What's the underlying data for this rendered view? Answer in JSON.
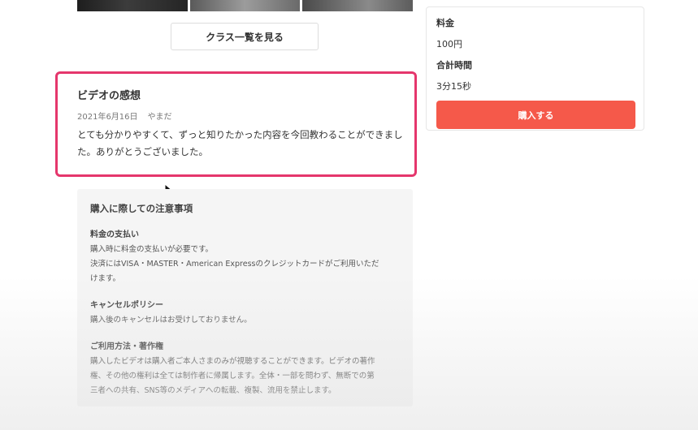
{
  "class_list_button": {
    "label": "クラス一覧を見る"
  },
  "review": {
    "title": "ビデオの感想",
    "date": "2021年6月16日",
    "author": "やまだ",
    "body_line1": "とても分かりやすくて、ずっと知りたかった内容を今回教わることができまし",
    "body_line2": "た。ありがとうございました。"
  },
  "notes": {
    "title": "購入に際しての注意事項",
    "payment": {
      "heading": "料金の支払い",
      "line1": "購入時に料金の支払いが必要です。",
      "line2": "決済にはVISA・MASTER・American Expressのクレジットカードがご利用いただ",
      "line3": "けます。"
    },
    "cancel": {
      "heading": "キャンセルポリシー",
      "line1": "購入後のキャンセルはお受けしておりません。"
    },
    "usage": {
      "heading": "ご利用方法・著作権",
      "line1": "購入したビデオは購入者ご本人さまのみが視聴することができます。ビデオの著作",
      "line2": "権、その他の権利は全ては制作者に帰属します。全体・一部を問わず、無断での第",
      "line3": "三者への共有、SNS等のメディアへの転載、複製、流用を禁止します。"
    }
  },
  "price_panel": {
    "price_label": "料金",
    "price_value": "100円",
    "duration_label": "合計時間",
    "duration_value": "3分15秒",
    "buy_label": "購入する"
  },
  "colors": {
    "accent_buy": "#f5594a",
    "highlight_border": "#e5366c"
  }
}
